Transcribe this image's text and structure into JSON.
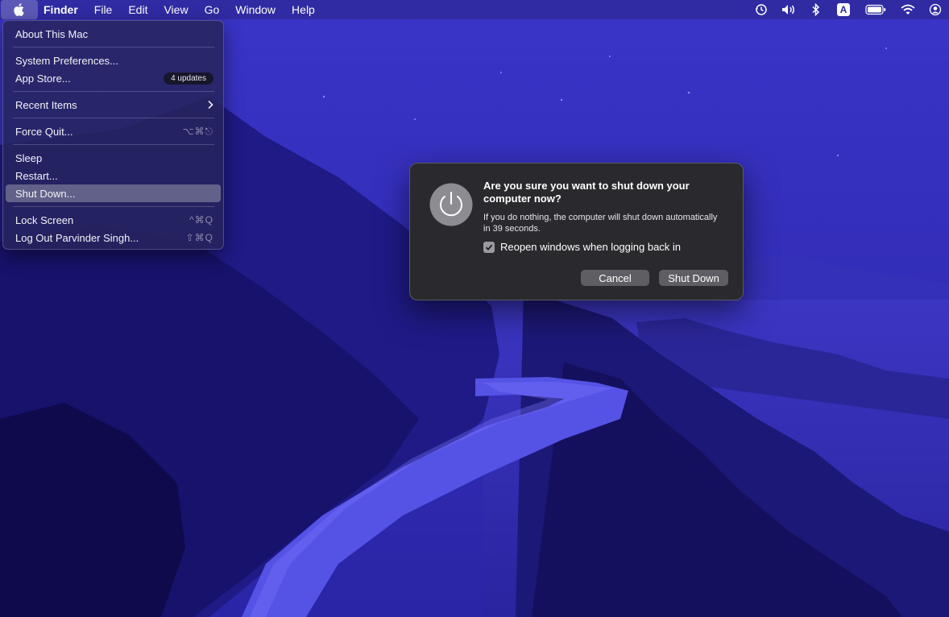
{
  "menubar": {
    "app_name": "Finder",
    "menus": [
      "File",
      "Edit",
      "View",
      "Go",
      "Window",
      "Help"
    ],
    "status_icons": [
      "time-machine-icon",
      "volume-icon",
      "bluetooth-icon",
      "input-source-icon",
      "battery-icon",
      "wifi-icon",
      "user-icon"
    ],
    "input_source_letter": "A"
  },
  "apple_menu": {
    "items": [
      {
        "label": "About This Mac"
      },
      {
        "label": "System Preferences..."
      },
      {
        "label": "App Store...",
        "badge": "4 updates"
      },
      {
        "label": "Recent Items"
      },
      {
        "label": "Force Quit...",
        "shortcut": "⌥⌘⎋"
      },
      {
        "label": "Sleep"
      },
      {
        "label": "Restart..."
      },
      {
        "label": "Shut Down...",
        "selected": true
      },
      {
        "label": "Lock Screen",
        "shortcut": "^⌘Q"
      },
      {
        "label": "Log Out Parvinder Singh...",
        "shortcut": "⇧⌘Q"
      }
    ]
  },
  "dialog": {
    "title": "Are you sure you want to shut down your computer now?",
    "message": "If you do nothing, the computer will shut down automatically in 39 seconds.",
    "checkbox_label": "Reopen windows when logging back in",
    "checkbox_checked": true,
    "cancel_label": "Cancel",
    "confirm_label": "Shut Down"
  },
  "colors": {
    "wallpaper": "#2c27a8",
    "dialog_bg": "#2a2a2e",
    "menu_selected": "#8e8ea8"
  }
}
